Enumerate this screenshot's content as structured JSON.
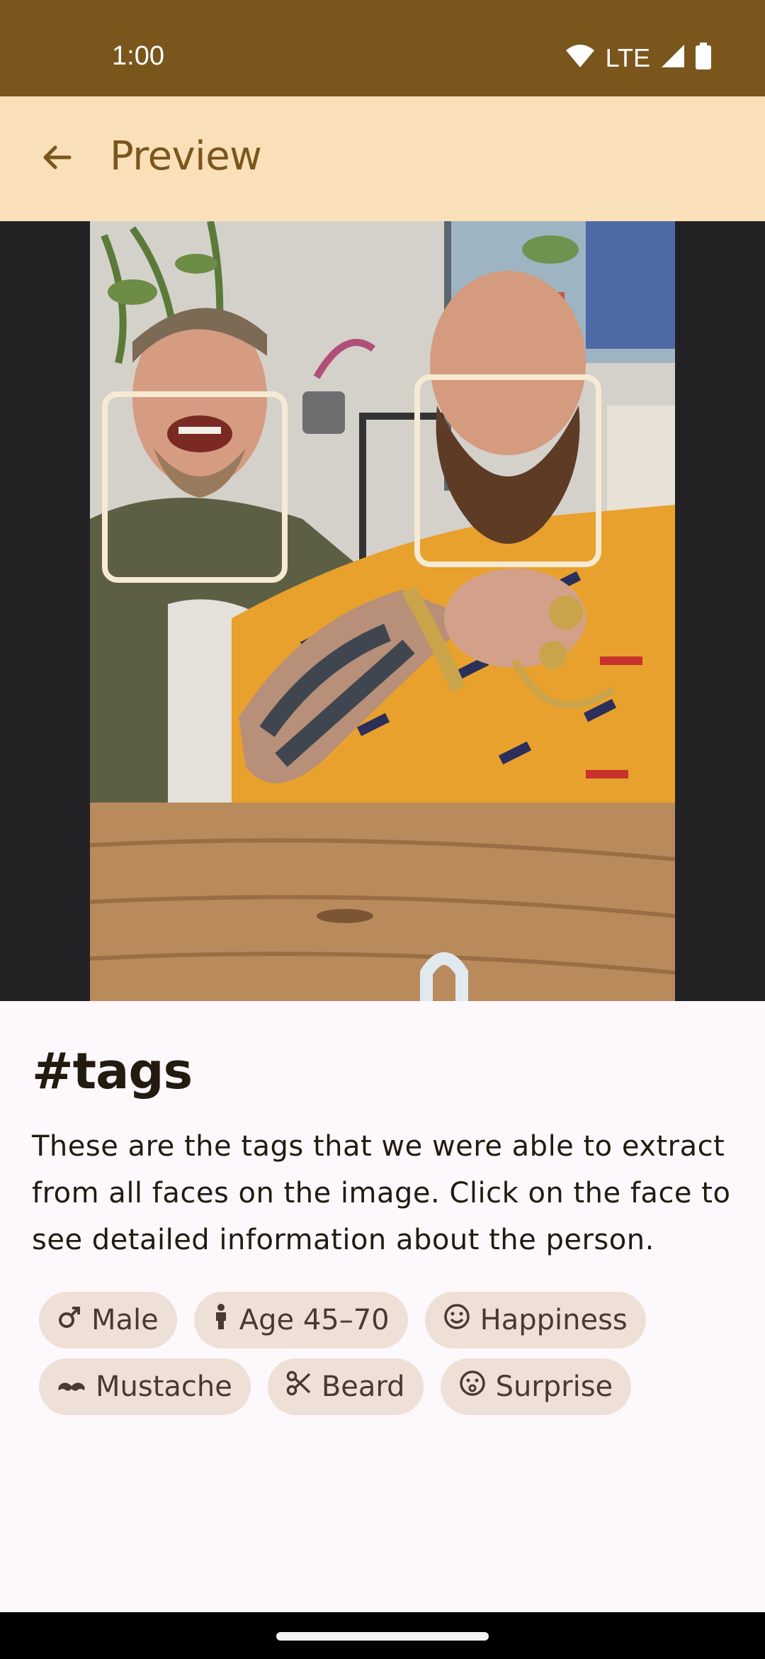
{
  "status_bar": {
    "time": "1:00",
    "network": "LTE",
    "icons": [
      "wifi-icon",
      "cellular-signal-icon",
      "battery-icon"
    ]
  },
  "app_bar": {
    "title": "Preview",
    "back_icon": "arrow-back-icon"
  },
  "preview": {
    "detected_faces": 2
  },
  "tags_section": {
    "title": "#tags",
    "description": "These are the tags that we were able to extract from all faces on the image. Click on the face to see detailed information about the person.",
    "chips": [
      {
        "label": "Male",
        "icon": "male-icon"
      },
      {
        "label": "Age 45–70",
        "icon": "person-icon"
      },
      {
        "label": "Happiness",
        "icon": "smile-icon"
      },
      {
        "label": "Mustache",
        "icon": "mustache-icon"
      },
      {
        "label": "Beard",
        "icon": "scissors-icon"
      },
      {
        "label": "Surprise",
        "icon": "surprised-face-icon"
      }
    ]
  },
  "colors": {
    "status_bar": "#7a561d",
    "app_bar": "#fae0b8",
    "title": "#7a561d",
    "chip_bg": "#eee0d6",
    "chip_text": "#473a2f",
    "sheet_bg": "#fdf8fc",
    "face_box": "#f6ead3"
  }
}
